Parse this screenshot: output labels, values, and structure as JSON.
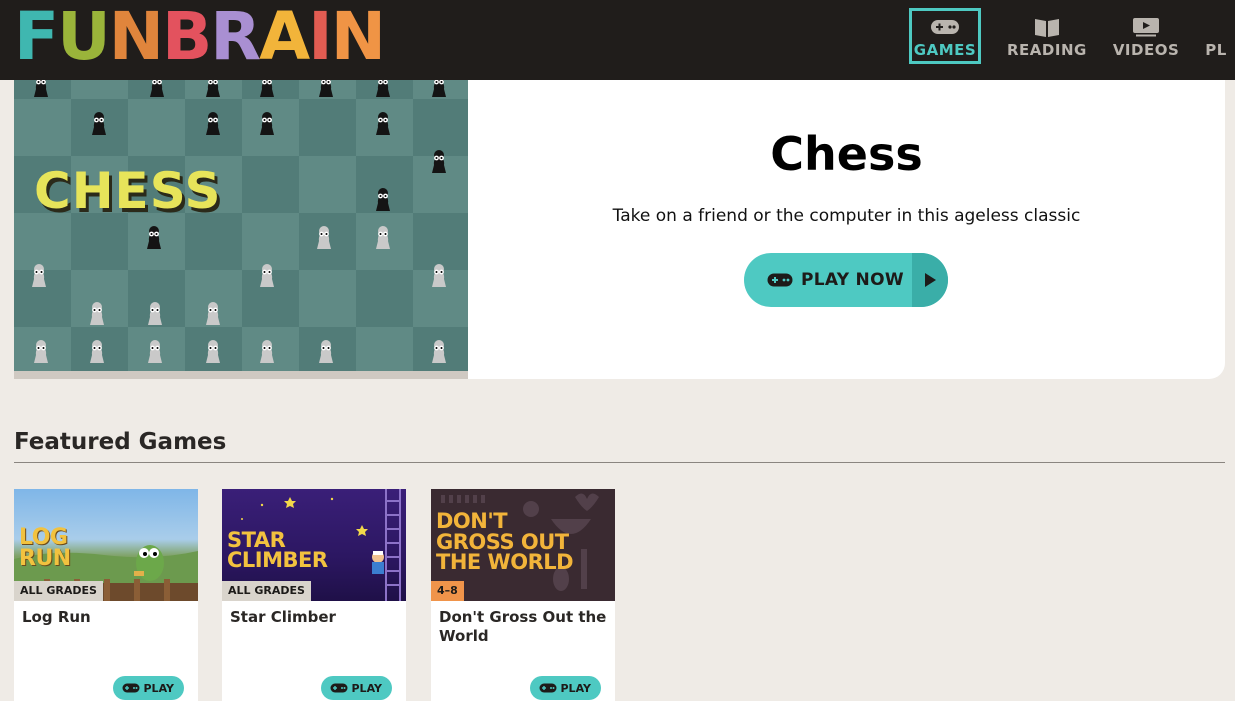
{
  "header": {
    "logo_letters": [
      {
        "char": "F",
        "color": "#3fb7b0"
      },
      {
        "char": "U",
        "color": "#9ab43a"
      },
      {
        "char": "N",
        "color": "#e0853c"
      },
      {
        "char": "B",
        "color": "#e3525e"
      },
      {
        "char": "R",
        "color": "#a98fd2"
      },
      {
        "char": "A",
        "color": "#f2b43a"
      },
      {
        "char": "I",
        "color": "#e25c52"
      },
      {
        "char": "N",
        "color": "#f09445"
      }
    ],
    "nav": [
      {
        "label": "GAMES",
        "icon": "gamepad-icon",
        "active": true
      },
      {
        "label": "READING",
        "icon": "book-icon",
        "active": false
      },
      {
        "label": "VIDEOS",
        "icon": "video-icon",
        "active": false
      },
      {
        "label": "PL",
        "icon": "",
        "active": false
      }
    ]
  },
  "hero": {
    "board_label": "CHESS",
    "title": "Chess",
    "description": "Take on a friend or the computer in this ageless classic",
    "play_label": "PLAY NOW"
  },
  "featured": {
    "title": "Featured Games",
    "cards": [
      {
        "title": "Log Run",
        "thumb_text": [
          "LOG",
          "RUN"
        ],
        "badge": "ALL GRADES",
        "play_label": "PLAY"
      },
      {
        "title": "Star Climber",
        "thumb_text": [
          "STAR",
          "CLIMBER"
        ],
        "badge": "ALL GRADES",
        "play_label": "PLAY"
      },
      {
        "title": "Don't Gross Out the World",
        "thumb_text": [
          "DON'T",
          "GROSS OUT",
          "THE WORLD"
        ],
        "badge": "4–8",
        "play_label": "PLAY"
      }
    ]
  },
  "colors": {
    "accent": "#4ec9c2",
    "header_bg": "#201d1b",
    "page_bg": "#efebe6"
  }
}
